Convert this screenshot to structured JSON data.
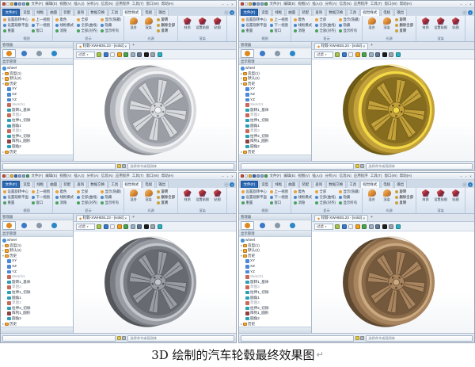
{
  "caption": {
    "text": "3D 绘制的汽车轮毂最终效果图",
    "mark": "↵"
  },
  "chrome": {
    "quick_icons": [
      {
        "name": "app-logo-icon",
        "color": "#d04a3a"
      },
      {
        "name": "new-file-icon",
        "color": "#f2f5f8"
      },
      {
        "name": "open-file-icon",
        "color": "#e8b33c"
      },
      {
        "name": "save-icon",
        "color": "#3a6ab0"
      },
      {
        "name": "undo-icon",
        "color": "#89a8d0"
      },
      {
        "name": "redo-icon",
        "color": "#89a8d0"
      },
      {
        "name": "regenerate-icon",
        "color": "#49a25c"
      }
    ],
    "menu": [
      "文件(F)",
      "编辑(E)",
      "视图(V)",
      "插入(I)",
      "分析(A)",
      "信息(N)",
      "应用程序",
      "工具(T)",
      "窗口(W)",
      "帮助(H)"
    ],
    "window_controls": [
      {
        "name": "minimize-icon",
        "glyph": "–"
      },
      {
        "name": "restore-icon",
        "glyph": "▫"
      },
      {
        "name": "close-icon",
        "glyph": "×"
      }
    ],
    "tabs": [
      "文件(F)",
      "造型",
      "线框",
      "曲面",
      "装配",
      "查询",
      "数据交换",
      "工具",
      "视觉样式",
      "电极",
      "输出"
    ],
    "active_tab": "视觉样式",
    "tabbar_right": [
      {
        "name": "collapse-ribbon-icon",
        "glyph": "ˆ"
      },
      {
        "name": "help-icon",
        "glyph": "?"
      }
    ],
    "ribbon": {
      "g1": {
        "label": "视图",
        "items": [
          "设置旋转中心",
          "设置观察平面",
          "重置",
          "上一视图",
          "下一视图",
          "窗口"
        ]
      },
      "g2": {
        "label": "显示",
        "items": [
          "着色",
          "线框模式",
          "消隐",
          "全部",
          "全部(曲线)",
          "全部(对齐)",
          "显示(隐藏)",
          "隐藏",
          "显示所有"
        ]
      },
      "g3": {
        "label": "光源",
        "big": [
          "混合",
          "渲染"
        ],
        "small": [
          "旋转",
          "删除全部",
          "反转"
        ]
      },
      "g4": {
        "label": "渲染",
        "big": [
          "材质",
          "设置贴图",
          "贴图"
        ]
      }
    },
    "panel": {
      "header": "管理器",
      "sub": "显示管理",
      "tabs": [
        {
          "name": "history-manager-tab",
          "color": "#e08820"
        },
        {
          "name": "assembly-manager-tab",
          "color": "#3a78c8"
        },
        {
          "name": "redefine-manager-tab",
          "color": "#8898a8"
        },
        {
          "name": "view-manager-tab",
          "color": "#2a88c8"
        }
      ]
    },
    "tree": {
      "items": [
        {
          "label": "wheel",
          "icon": "root",
          "indent": 0
        },
        {
          "label": "造型(1)",
          "icon": "folder",
          "indent": 0,
          "arrow": "▸"
        },
        {
          "label": "默认(2)",
          "icon": "folder",
          "indent": 0,
          "arrow": "▸"
        },
        {
          "label": "历史",
          "icon": "folder",
          "indent": 0,
          "arrow": "▾"
        },
        {
          "label": "XY",
          "icon": "plane",
          "indent": 1
        },
        {
          "label": "XZ",
          "icon": "plane",
          "indent": 1
        },
        {
          "label": "YZ",
          "icon": "plane",
          "indent": 1
        },
        {
          "label": "Sketch1",
          "icon": "sketch",
          "indent": 1,
          "dim": true
        },
        {
          "label": "旋转1_基体",
          "icon": "feature",
          "indent": 1
        },
        {
          "label": "草图2",
          "icon": "sketch",
          "indent": 1,
          "dim": true
        },
        {
          "label": "拉伸1_切除",
          "icon": "feature",
          "indent": 1
        },
        {
          "label": "圆角1",
          "icon": "feature",
          "indent": 1
        },
        {
          "label": "草图3",
          "icon": "sketch",
          "indent": 1,
          "dim": true
        },
        {
          "label": "拉伸2_切除",
          "icon": "feature",
          "indent": 1
        },
        {
          "label": "阵列1_圆形",
          "icon": "pattern",
          "indent": 1
        },
        {
          "label": "圆角2",
          "icon": "feature",
          "indent": 1
        },
        {
          "label": "历史",
          "icon": "folder",
          "indent": 0,
          "arrow": "▸"
        }
      ]
    },
    "doc_tab": {
      "title": "轮毂-XWHEEL23 - [solid]",
      "close": "×",
      "new_tab": "+"
    },
    "viewport": {
      "filter_label": "过滤",
      "toolbar_icons": [
        {
          "name": "shade-mode-icon",
          "color": "#a2c24a"
        },
        {
          "name": "wireframe-mode-icon",
          "color": "#3a78c8"
        },
        {
          "name": "background-icon",
          "color": "#f2f4f6"
        },
        {
          "name": "light-icon",
          "color": "#f0a020"
        },
        {
          "name": "scene-icon",
          "color": "#4aa24a"
        },
        {
          "name": "grid-icon",
          "color": "#9ab0c4"
        },
        {
          "name": "annotate-icon",
          "color": "#607890"
        },
        {
          "name": "black-material-icon",
          "color": "#1c1c1c"
        },
        {
          "name": "striped-material-icon",
          "color": "#9aa4ae"
        },
        {
          "name": "render-ball-icon",
          "color": "#2ab0c0"
        }
      ]
    },
    "status": {
      "icons": [
        {
          "name": "prompt-icon",
          "color": "#e8c840"
        },
        {
          "name": "list-icon",
          "color": "#b0b8c0"
        }
      ],
      "hint": "选择命令或观测体"
    }
  },
  "windows": [
    {
      "name": "silver",
      "wheel": {
        "face": "#d7d9dd",
        "mid": "#b2b6bc",
        "dark": "#83878d",
        "hi": "#f2f3f5"
      }
    },
    {
      "name": "gold",
      "wheel": {
        "face": "#c3a13b",
        "mid": "#9d7f27",
        "dark": "#6d5a16",
        "hi": "#f2d945"
      }
    },
    {
      "name": "gunmetal",
      "wheel": {
        "face": "#999da3",
        "mid": "#7a7e84",
        "dark": "#53565b",
        "hi": "#c3c6cb"
      }
    },
    {
      "name": "bronze",
      "wheel": {
        "face": "#a8845f",
        "mid": "#8a6a48",
        "dark": "#5e4830",
        "hi": "#c9a980"
      }
    }
  ]
}
